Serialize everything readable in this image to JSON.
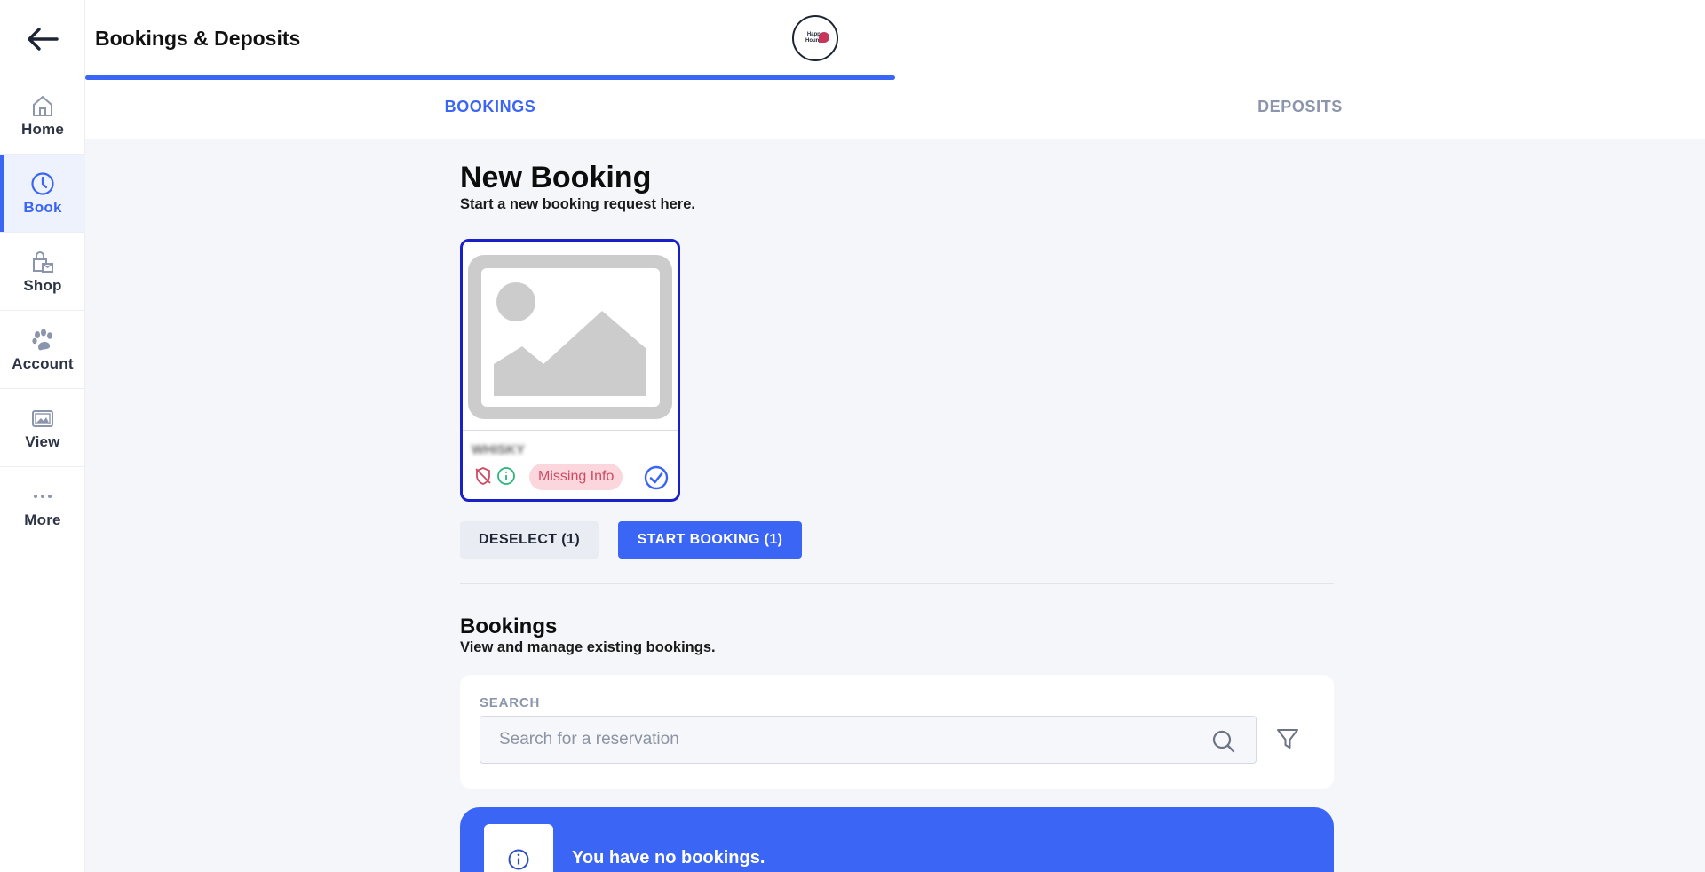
{
  "header": {
    "title": "Bookings & Deposits",
    "logo_text_1": "Happy",
    "logo_text_2": "Houndz"
  },
  "sidebar": {
    "items": [
      {
        "label": "Home",
        "icon": "home-icon"
      },
      {
        "label": "Book",
        "icon": "clock-icon",
        "active": true
      },
      {
        "label": "Shop",
        "icon": "shop-icon"
      },
      {
        "label": "Account",
        "icon": "paw-icon"
      },
      {
        "label": "View",
        "icon": "image-icon"
      },
      {
        "label": "More",
        "icon": "more-icon"
      }
    ]
  },
  "tabs": {
    "bookings": "BOOKINGS",
    "deposits": "DEPOSITS",
    "active": "bookings"
  },
  "new_booking": {
    "title": "New Booking",
    "subtitle": "Start a new booking request here.",
    "pet": {
      "name": "WHISKY",
      "badge": "Missing Info",
      "selected": true
    },
    "deselect_label": "DESELECT (1)",
    "start_label": "START BOOKING (1)"
  },
  "bookings": {
    "title": "Bookings",
    "subtitle": "View and manage existing bookings.",
    "search_label": "SEARCH",
    "search_placeholder": "Search for a reservation",
    "search_value": "",
    "empty_message": "You have no bookings."
  },
  "colors": {
    "accent": "#3a65f5",
    "badge_bg": "#fbd6dc",
    "badge_text": "#d14a63",
    "card_border": "#1a20c8"
  }
}
